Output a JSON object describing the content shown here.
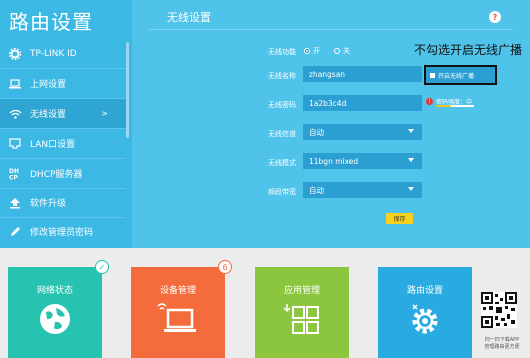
{
  "sidebar": {
    "brand": "路由设置",
    "items": [
      {
        "label": "TP-LINK ID",
        "icon": "gear-icon"
      },
      {
        "label": "上网设置",
        "icon": "laptop-icon"
      },
      {
        "label": "无线设置",
        "icon": "wifi-icon",
        "active": true,
        "arrow": ">"
      },
      {
        "label": "LAN口设置",
        "icon": "lan-port-icon"
      },
      {
        "label": "DHCP服务器",
        "icon": "dhcp-icon"
      },
      {
        "label": "软件升级",
        "icon": "upload-icon"
      },
      {
        "label": "修改管理员密码",
        "icon": "pencil-icon"
      }
    ]
  },
  "panel": {
    "title": "无线设置",
    "help": "?"
  },
  "form": {
    "wifi_label": "无线功能",
    "wifi_on": "开",
    "wifi_off": "关",
    "ssid_label": "无线名称",
    "ssid_value": "zhangsan",
    "broadcast_label": "开启无线广播",
    "password_label": "无线密码",
    "password_value": "1a2b3c4d",
    "strength_label": "密码强度：中",
    "channel_label": "无线信道",
    "channel_value": "自动",
    "mode_label": "无线模式",
    "mode_value": "11bgn mixed",
    "bandwidth_label": "频段带宽",
    "bandwidth_value": "自动",
    "save_label": "保存"
  },
  "annotation": "不勾选开启无线广播",
  "tiles": [
    {
      "title": "网络状态",
      "color": "#27c3b0",
      "icon": "globe-icon",
      "badge": "✓"
    },
    {
      "title": "设备管理",
      "color": "#f46c3b",
      "icon": "laptop-icon",
      "badge": "6"
    },
    {
      "title": "应用管理",
      "color": "#8cc63f",
      "icon": "apps-grid-icon"
    },
    {
      "title": "路由设置",
      "color": "#29abe2",
      "icon": "settings-gear-icon"
    }
  ],
  "qr": {
    "caption1": "扫一扫下载APP",
    "caption2": "管理路由更方便"
  },
  "colors": {
    "accent": "#4fc3ea",
    "sidebar": "#3bb8e3",
    "field": "#2b9fd2",
    "save": "#f7d11e"
  }
}
